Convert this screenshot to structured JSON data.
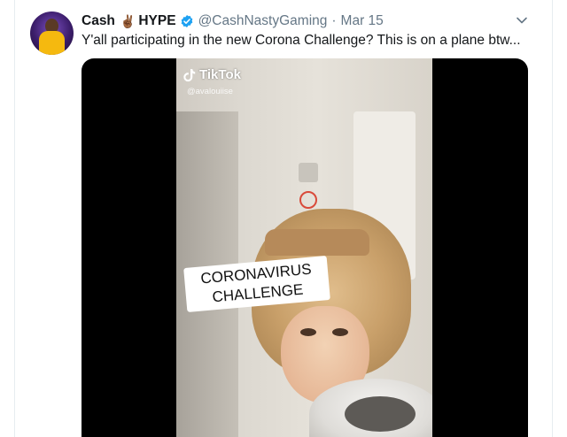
{
  "tweet": {
    "display_name": "Cash",
    "name_emoji": "✌🏾",
    "name_suffix": "HYPE",
    "verified": true,
    "handle": "@CashNastyGaming",
    "separator": "·",
    "date": "Mar 15",
    "text": "Y'all participating in the new Corona Challenge? This is on a plane btw..."
  },
  "media": {
    "watermark_brand": "TikTok",
    "watermark_user": "@avalouiise",
    "caption_line1": "CORONAVIRUS",
    "caption_line2": "CHALLENGE"
  },
  "icons": {
    "verified": "verified-badge-icon",
    "menu": "chevron-down-icon",
    "tiktok": "tiktok-logo-icon"
  },
  "colors": {
    "verified_blue": "#1da1f2",
    "text_primary": "#14171a",
    "text_secondary": "#657786"
  }
}
